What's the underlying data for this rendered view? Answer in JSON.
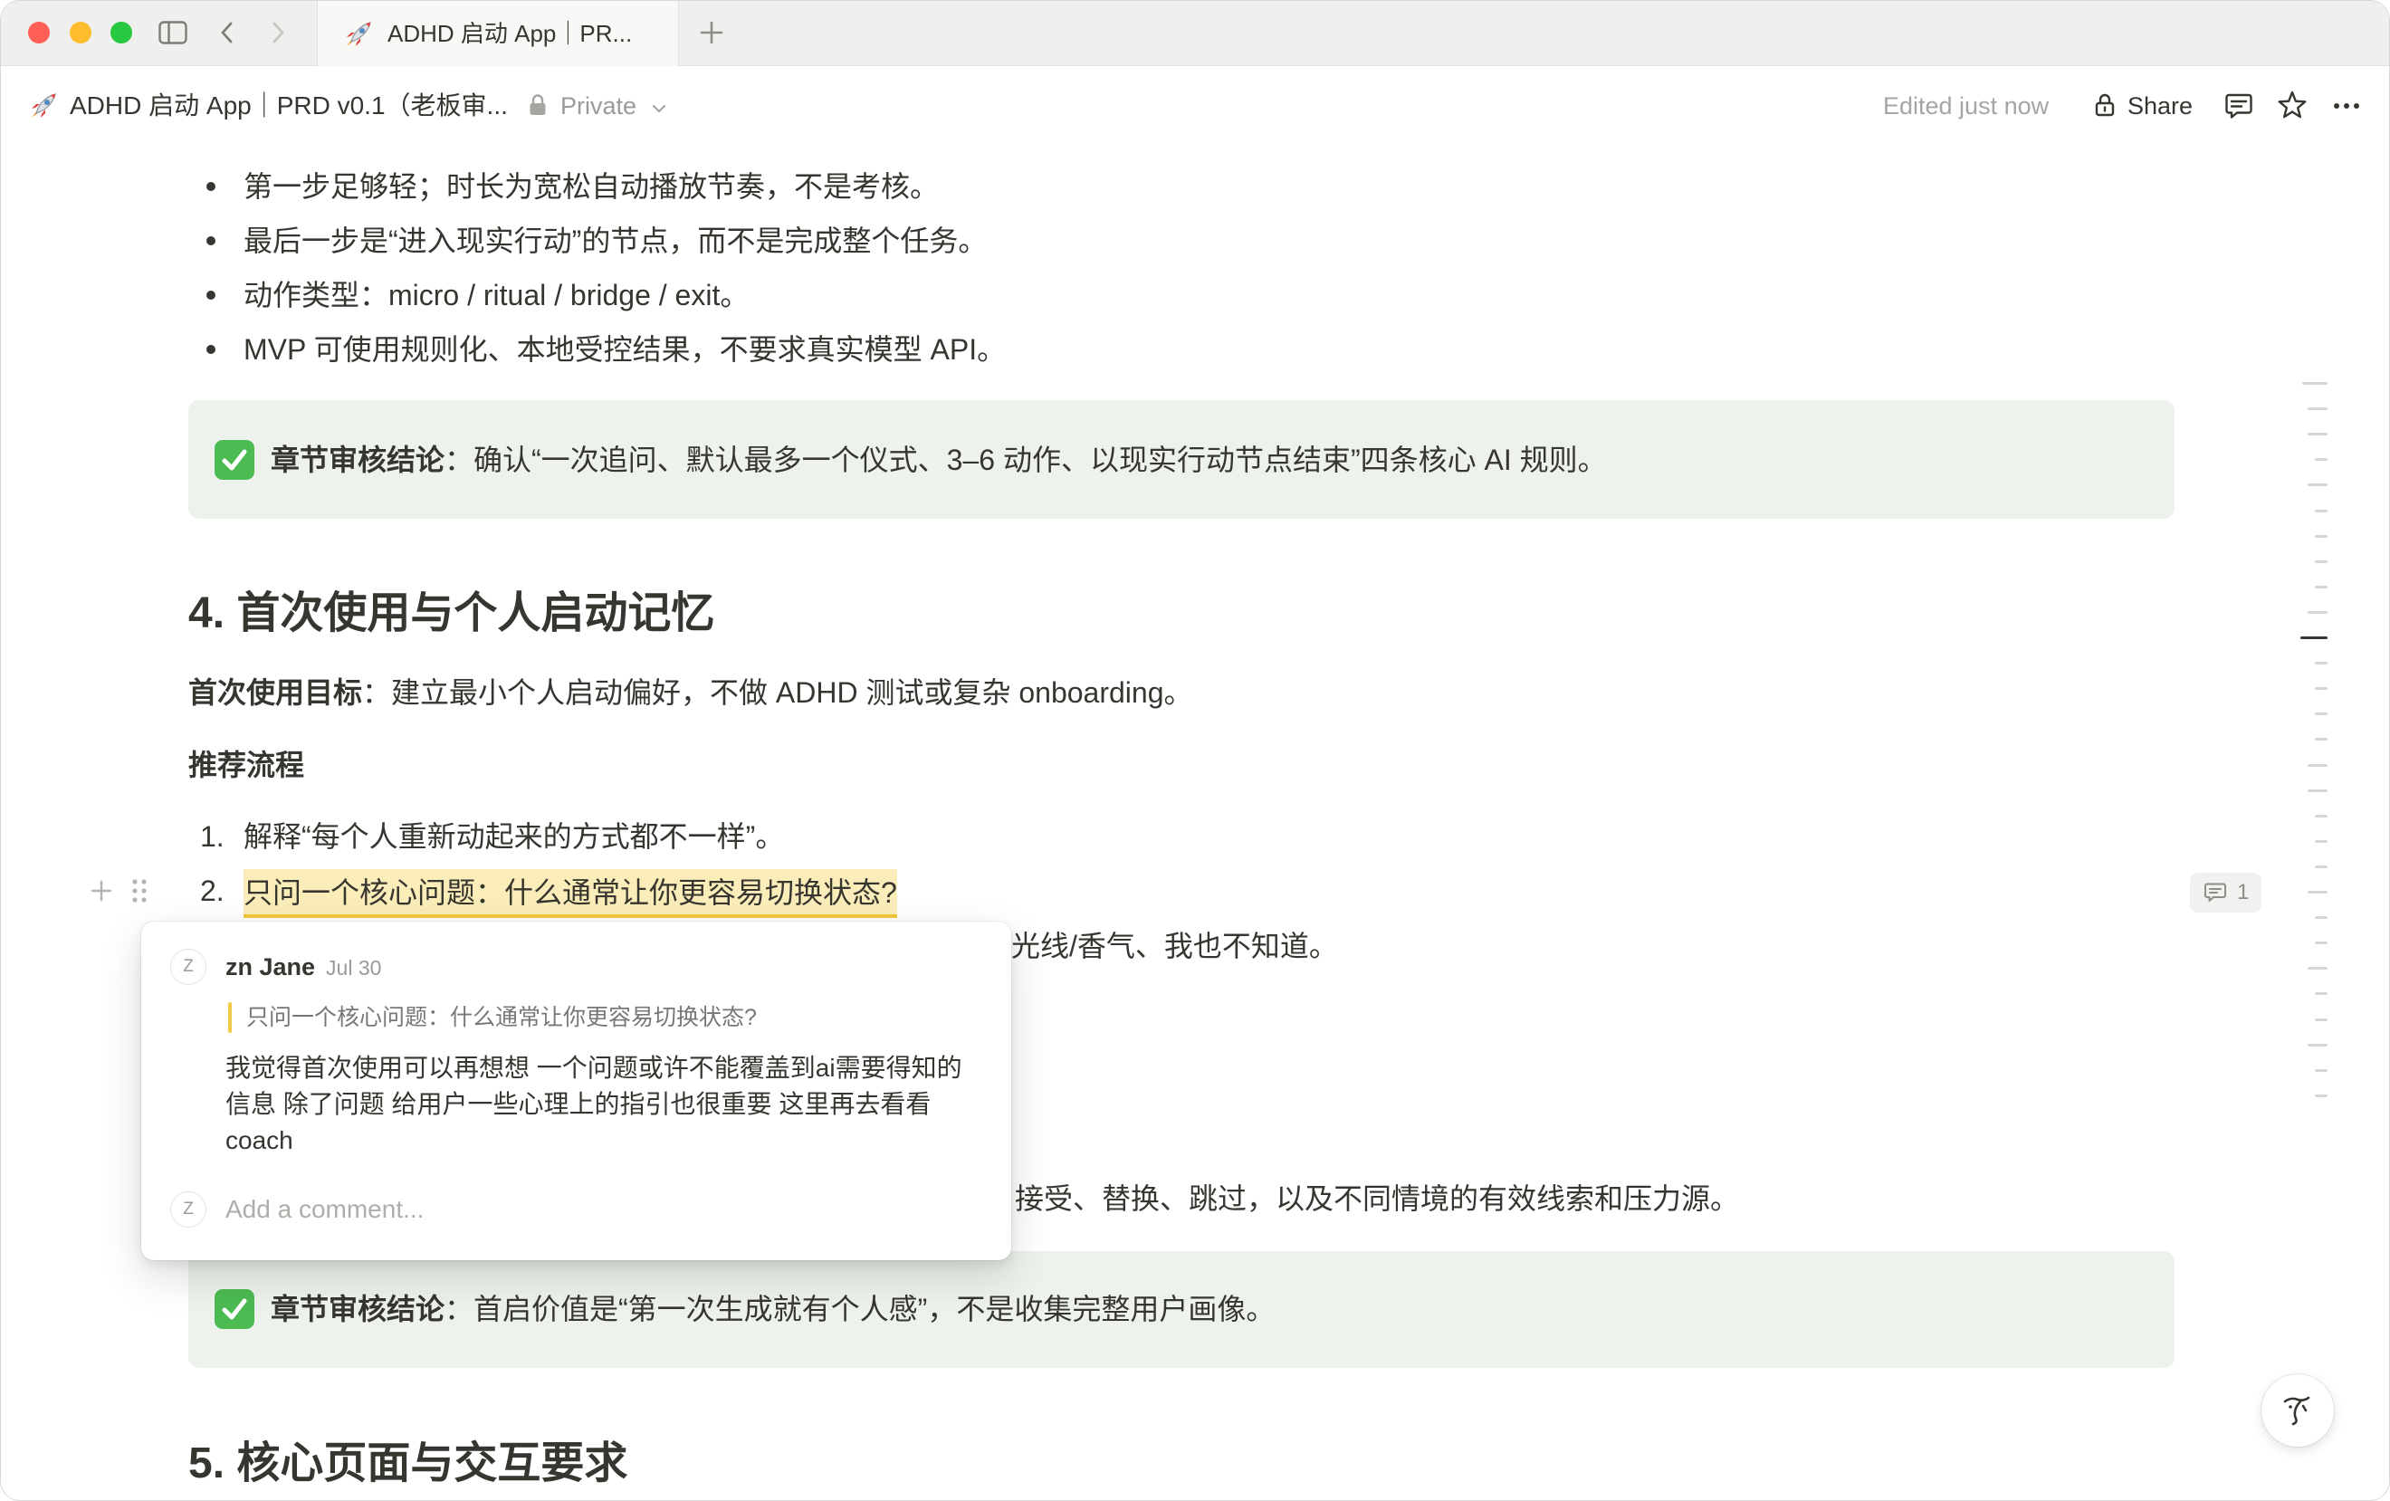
{
  "window": {
    "tab_title": "ADHD 启动 App｜PR..."
  },
  "topbar": {
    "page_title": "ADHD 启动 App｜PRD v0.1（老板审...",
    "privacy": "Private",
    "edited": "Edited just now",
    "share_label": "Share"
  },
  "content": {
    "bullets": [
      "第一步足够轻；时长为宽松自动播放节奏，不是考核。",
      "最后一步是“进入现实行动”的节点，而不是完成整个任务。",
      "动作类型：micro / ritual / bridge / exit。",
      "MVP 可使用规则化、本地受控结果，不要求真实模型 API。"
    ],
    "callout1": {
      "bold": "章节审核结论",
      "text": "：确认“一次追问、默认最多一个仪式、3–6 动作、以现实行动节点结束”四条核心 AI 规则。"
    },
    "heading4": "4. 首次使用与个人启动记忆",
    "goal": {
      "bold": "首次使用目标",
      "text": "：建立最小个人启动偏好，不做 ADHD 测试或复杂 onboarding。"
    },
    "flow_label": "推荐流程",
    "steps": [
      {
        "num": "1.",
        "text": "解释“每个人重新动起来的方式都不一样”。"
      },
      {
        "num": "2.",
        "text": "只问一个核心问题：什么通常让你更容易切换状态?"
      }
    ],
    "step3_visible_fragment": "光线/香气、我也不知道。",
    "paragraph_visible_fragment": "接受、替换、跳过，以及不同情境的有效线索和压力源。",
    "callout2": {
      "bold": "章节审核结论",
      "text": "：首启价值是“第一次生成就有个人感”，不是收集完整用户画像。"
    },
    "heading5": "5. 核心页面与交互要求"
  },
  "comment_indicator": {
    "count": "1"
  },
  "comment_popup": {
    "author_initial": "Z",
    "author": "zn Jane",
    "date": "Jul 30",
    "quote": "只问一个核心问题：什么通常让你更容易切换状态?",
    "body": "我觉得首次使用可以再想想 一个问题或许不能覆盖到ai需要得知的信息 除了问题 给用户一些心理上的指引也很重要 这里再去看看coach",
    "reply_initial": "Z",
    "reply_placeholder": "Add a comment..."
  },
  "colors": {
    "text": "#37352f",
    "muted": "#9b9a97",
    "callout_bg": "#edf3ec",
    "highlight_bg": "#fbedb9",
    "highlight_underline": "#f0c53a",
    "check_green": "#4cbb52",
    "quote_bar": "#f3cb4b",
    "traffic_close": "#ff5f57",
    "traffic_minimize": "#febc2e",
    "traffic_zoom": "#28c840"
  },
  "icons": {
    "sidebar_toggle": "sidebar-toggle-icon",
    "back": "chevron-left-icon",
    "forward": "chevron-right-icon",
    "new_tab": "plus-icon",
    "page": "rocket-icon",
    "privacy": "lock-icon",
    "privacy_menu": "chevron-down-icon",
    "share": "lock-icon",
    "comments": "comment-icon",
    "favorite": "star-icon",
    "more": "more-horizontal-icon",
    "callout": "check-mark-button-icon",
    "block_add": "plus-icon",
    "block_drag": "drag-handle-icon",
    "notion_ai": "notion-ai-face-icon"
  }
}
